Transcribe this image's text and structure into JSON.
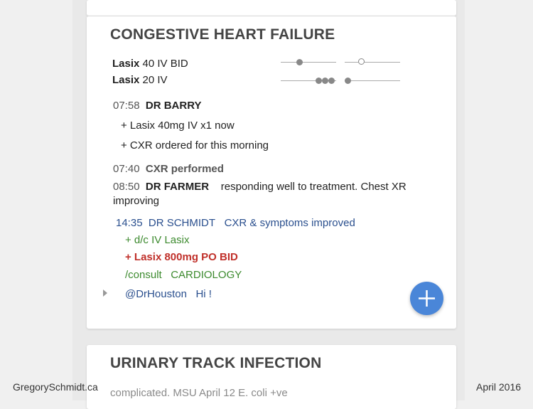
{
  "cards": {
    "chf": {
      "title": "CONGESTIVE HEART FAILURE",
      "meds": [
        {
          "name": "Lasix",
          "dose": "40 IV BID"
        },
        {
          "name": "Lasix",
          "dose": "20 IV"
        }
      ],
      "notes": {
        "n1_time": "07:58",
        "n1_author": "DR BARRY",
        "n1_line1": "+ Lasix 40mg IV x1 now",
        "n1_line2": "+ CXR ordered for this morning",
        "n2_time": "07:40",
        "n2_text": "CXR performed",
        "n3_time": "08:50",
        "n3_author": "DR FARMER",
        "n3_text": "responding well to treatment. Chest XR",
        "n3_text2": "improving",
        "n4_time": "14:35",
        "n4_author": "DR SCHMIDT",
        "n4_text": "CXR & symptoms improved",
        "order1": "+ d/c IV Lasix",
        "order2": "+ Lasix 800mg PO BID",
        "consult_cmd": "/consult",
        "consult_target": "CARDIOLOGY",
        "mention": "@DrHouston",
        "mention_text": "Hi !"
      }
    },
    "uti": {
      "title": "URINARY TRACK INFECTION",
      "subtitle": "complicated.  MSU April 12 E. coli +ve"
    }
  },
  "footer": {
    "left": "GregorySchmidt.ca",
    "right": "April 2016"
  },
  "colors": {
    "accent_blue": "#4a86d8",
    "note_blue": "#2a4f8e",
    "order_green": "#3c8a2e",
    "order_red": "#c0302a"
  },
  "icons": {
    "fab": "plus-icon",
    "expander": "caret-right-icon"
  }
}
